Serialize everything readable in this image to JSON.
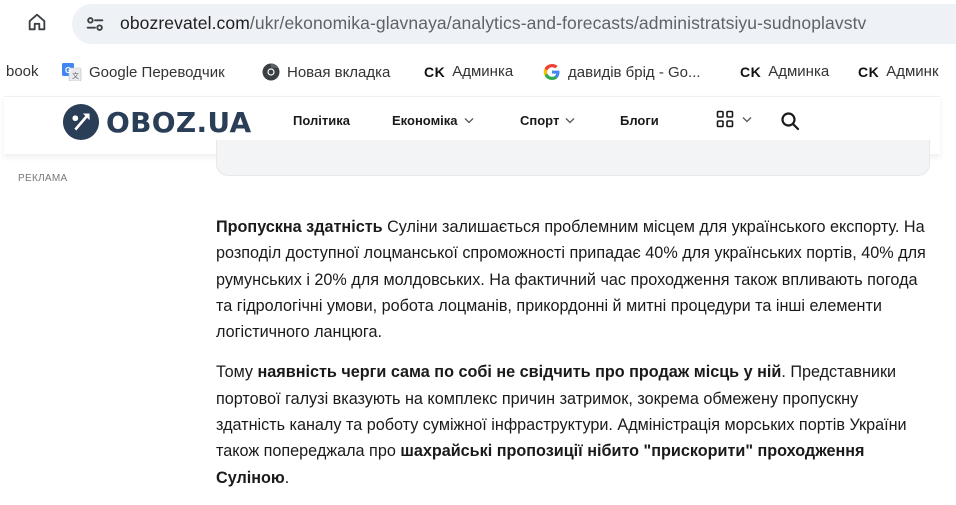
{
  "browser": {
    "url_host": "obozrevatel.com",
    "url_path": "/ukr/ekonomika-glavnaya/analytics-and-forecasts/administratsiyu-sudnoplavstv"
  },
  "bookmarks": [
    {
      "label": "book",
      "icon": "none"
    },
    {
      "label": "Google Переводчик",
      "icon": "google-translate-icon"
    },
    {
      "label": "Новая вкладка",
      "icon": "chrome-icon"
    },
    {
      "label": "Админка",
      "prefix": "CK",
      "icon": "ck-icon"
    },
    {
      "label": "давидів брід - Go...",
      "icon": "google-icon"
    },
    {
      "label": "Админка",
      "prefix": "CK",
      "icon": "ck-icon"
    },
    {
      "label": "Админк",
      "prefix": "CK",
      "icon": "ck-icon"
    }
  ],
  "site": {
    "logo_text": "OBOZ.UA",
    "nav": [
      {
        "label": "Політика",
        "dropdown": false
      },
      {
        "label": "Економіка",
        "dropdown": true
      },
      {
        "label": "Спорт",
        "dropdown": true
      },
      {
        "label": "Блоги",
        "dropdown": false
      }
    ],
    "brand_color": "#2a3e57"
  },
  "ad_label": "РЕКЛАМА",
  "article": {
    "p1": {
      "bold_lead": "Пропускна здатність",
      "rest": " Суліни залишається проблемним місцем для українського експорту. На розподіл доступної лоцманської спроможності припадає 40% для українських портів, 40% для румунських і 20% для молдовських. На фактичний час проходження також впливають погода та гідрологічні умови, робота лоцманів, прикордонні й митні процедури та інші елементи логістичного ланцюга."
    },
    "p2": {
      "lead": "Тому ",
      "bold1": "наявність черги сама по собі не свідчить про продаж місць у ній",
      "mid": ". Представники портової галузі вказують на комплекс причин затримок, зокрема обмежену пропускну здатність каналу та роботу суміжної інфраструктури. Адміністрація морських портів України також попереджала про ",
      "bold2": "шахрайські пропозиції нібито \"прискорити\" проходження Суліною",
      "end": "."
    }
  }
}
